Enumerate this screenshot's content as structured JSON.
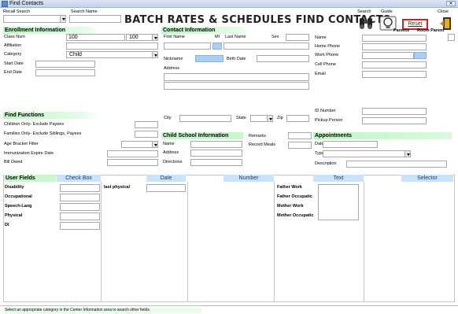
{
  "window": {
    "title": "Find Contacts",
    "close_label": "✕"
  },
  "toolbar": {
    "recall_search_label": "Recall Search",
    "search_name_label": "Search Name",
    "heading": "BATCH RATES & SCHEDULES FIND CONTACTS",
    "search_label": "Search",
    "guide_label": "Guide",
    "reset_label": "Reset",
    "close_label": "Close"
  },
  "enrollment": {
    "title": "Enrollment Information",
    "class_num_label": "Class Num",
    "class_num_value": "100",
    "class_num_select": "100",
    "affiliation_label": "Affiliation",
    "category_label": "Category",
    "category_value": "Child",
    "start_date_label": "Start Date",
    "end_date_label": "End Date"
  },
  "find_functions": {
    "title": "Find Functions",
    "children_only": "Children Only- Exclude Payees",
    "families_only": "Families Only- Exclude Siblings, Payees",
    "age_bracket": "Age Bracket Filter",
    "immunization": "Immunization Expire Date",
    "bill_owed": "Bill Owed"
  },
  "contact": {
    "title": "Contact Information",
    "first_name": "First Name",
    "mi": "MI",
    "last_name": "Last Name",
    "sex": "Sex",
    "nickname": "Nickname",
    "birth_date": "Birth Date",
    "address": "Address",
    "city": "City",
    "state": "State",
    "zip": "Zip"
  },
  "right_info": {
    "parents": "Parents",
    "room_parent": "Room Parent",
    "name": "Name",
    "home_phone": "Home Phone",
    "work_phone": "Work Phone",
    "cell_phone": "Cell Phone",
    "email": "Email",
    "id_number": "ID Number",
    "pickup_person": "Pickup Person"
  },
  "school": {
    "title": "Child School Information",
    "name": "Name",
    "address": "Address",
    "directions": "Directions",
    "remarks": "Remarks",
    "record_meals": "Record Meals"
  },
  "appointments": {
    "title": "Appointments",
    "date": "Date",
    "type": "Type",
    "description": "Description"
  },
  "user_fields": {
    "title": "User Fields",
    "col_checkbox": "Check Box",
    "col_date": "Date",
    "col_number": "Number",
    "col_text": "Text",
    "col_selector": "Selector",
    "checkbox_rows": [
      "Disability",
      "Occupational",
      "Speech-Lang",
      "Physical",
      "DI"
    ],
    "date_rows": [
      "last physical"
    ],
    "text_rows": [
      "Father Work",
      "Father Occupatic",
      "Mother Work",
      "Mother Occupatic"
    ]
  },
  "status": {
    "message": "Select an appropriate category in the Center Information area to search other fields."
  },
  "icons": {
    "search": "binoculars-icon",
    "guide": "lightbulb-icon",
    "close": "exit-door-icon"
  },
  "colors": {
    "section": "#bff5c4",
    "highlight": "#a9cff7",
    "reset_border": "#d42020",
    "header": "#c9e2ff"
  }
}
